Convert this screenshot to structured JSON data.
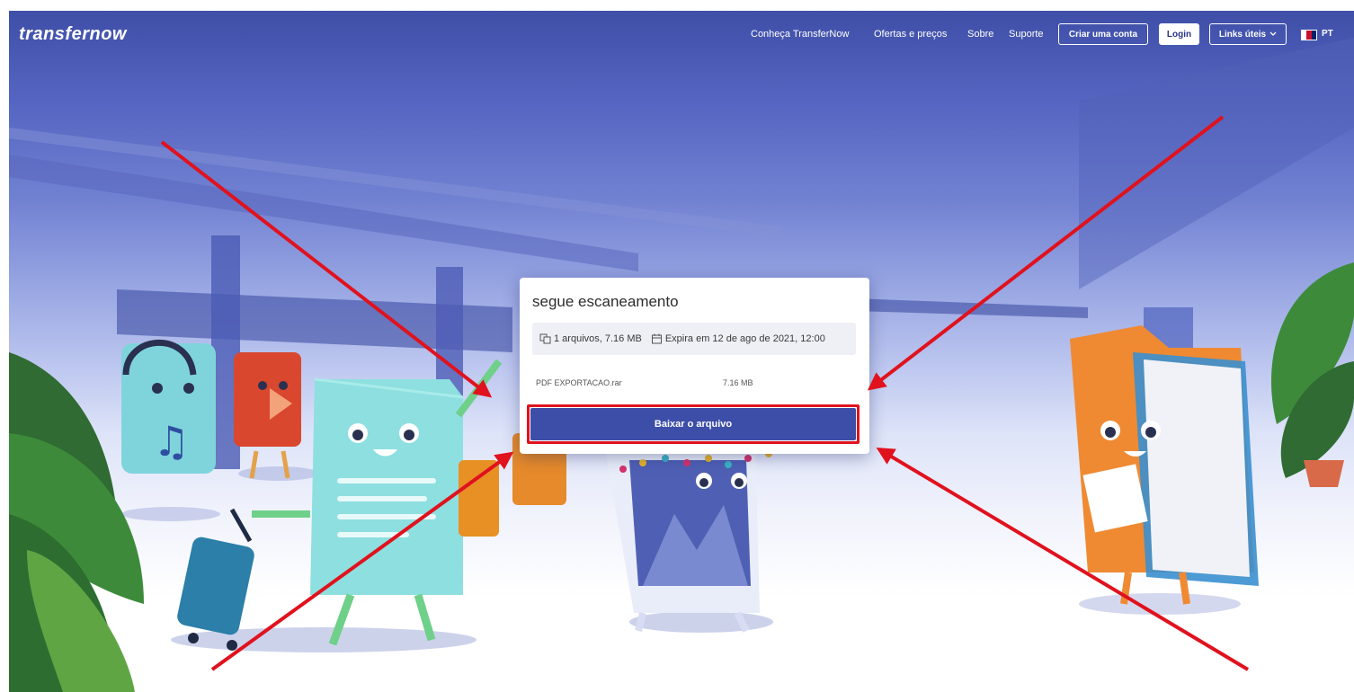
{
  "header": {
    "logo": "transfernow",
    "nav": {
      "discover": "Conheça TransferNow",
      "pricing": "Ofertas e preços",
      "about": "Sobre",
      "support": "Suporte"
    },
    "create_account": "Criar uma conta",
    "login": "Login",
    "useful_links": "Links úteis",
    "language": "PT"
  },
  "transfer": {
    "title": "segue escaneamento",
    "files_summary": "1 arquivos, 7.16 MB",
    "expiry": "Expira em 12 de ago de 2021, 12:00",
    "files": [
      {
        "name": "PDF EXPORTACAO.rar",
        "size": "7.16 MB"
      }
    ],
    "download_label": "Baixar o arquivo"
  },
  "annotation": {
    "highlight_color": "#e0121e",
    "arrow_color": "#e0121e",
    "arrow_count": 4
  },
  "colors": {
    "brand_blue": "#3d4ea8",
    "header_text": "#ffffff"
  },
  "icons": [
    "files-icon",
    "calendar-icon",
    "chevron-down-icon",
    "uk-flag-icon"
  ]
}
